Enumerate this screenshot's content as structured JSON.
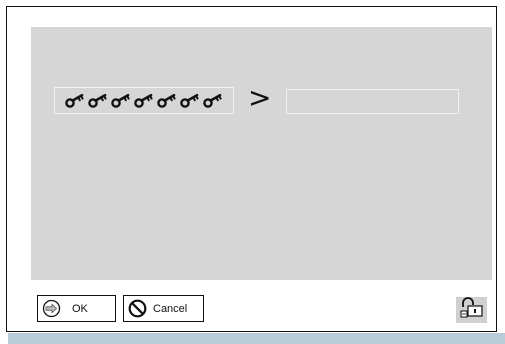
{
  "key_field": {
    "key_count": 7,
    "icon": "key-icon"
  },
  "arrow_glyph": ">",
  "new_key_field": {
    "value": "",
    "placeholder": ""
  },
  "buttons": {
    "ok_label": "OK",
    "ok_icon": "arrow-circle-right-icon",
    "cancel_label": "Cancel",
    "cancel_icon": "prohibited-icon",
    "lock_icon": "padlock-icon"
  },
  "colors": {
    "panel": "#d6d6d6",
    "strip": "#b7ccd8"
  }
}
